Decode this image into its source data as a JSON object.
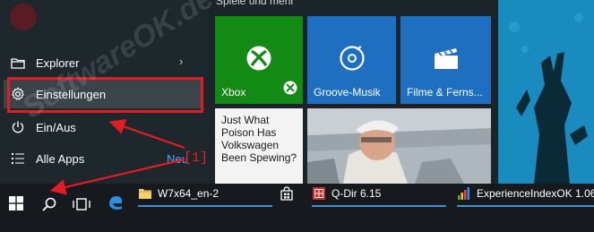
{
  "start_menu": {
    "items": [
      {
        "label": "Explorer",
        "icon": "folder-icon",
        "has_submenu": true
      },
      {
        "label": "Einstellungen",
        "icon": "gear-icon",
        "highlighted": true
      },
      {
        "label": "Ein/Aus",
        "icon": "power-icon"
      },
      {
        "label": "Alle Apps",
        "icon": "list-icon"
      }
    ],
    "neu_label": "Neu",
    "annotation_number": "[1]"
  },
  "tiles": {
    "group_title": "Spiele und mehr",
    "xbox": {
      "label": "Xbox",
      "color": "#138a13"
    },
    "groove": {
      "label": "Groove-Musik",
      "color": "#1e6fc2"
    },
    "films": {
      "label": "Filme & Ferns...",
      "color": "#1e6fc2"
    },
    "news": {
      "headline": "Just What Poison Has Volkswagen Been Spewing?"
    }
  },
  "taskbar": {
    "apps": [
      {
        "label": "W7x64_en-2",
        "icon": "folder-icon"
      },
      {
        "label": "",
        "icon": "store-icon"
      },
      {
        "label": "Q-Dir 6.15",
        "icon": "qdir-icon"
      },
      {
        "label": "ExperienceIndexOK 1.06",
        "icon": "chart-icon"
      }
    ]
  },
  "watermark": "SoftwareOK.de",
  "colors": {
    "accent": "#3f8fd6",
    "annotation_red": "#e01c24",
    "tile_green": "#138a13",
    "tile_blue": "#1e6fc2"
  }
}
